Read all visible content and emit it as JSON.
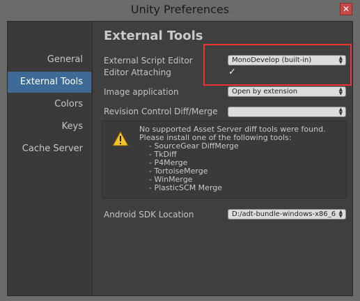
{
  "window": {
    "title": "Unity Preferences",
    "close_glyph": "✕"
  },
  "sidebar": {
    "items": [
      {
        "label": "General",
        "active": false
      },
      {
        "label": "External Tools",
        "active": true
      },
      {
        "label": "Colors",
        "active": false
      },
      {
        "label": "Keys",
        "active": false
      },
      {
        "label": "Cache Server",
        "active": false
      }
    ]
  },
  "main": {
    "title": "External Tools",
    "external_script_editor": {
      "label": "External Script Editor",
      "value": "MonoDevelop (built-in)"
    },
    "editor_attaching": {
      "label": "Editor Attaching",
      "checked": true,
      "check_glyph": "✓"
    },
    "image_application": {
      "label": "Image application",
      "value": "Open by extension"
    },
    "revision_control": {
      "label": "Revision Control Diff/Merge",
      "value": ""
    },
    "help": {
      "icon": "warning-icon",
      "lines": [
        "No supported Asset Server diff tools were found.",
        "Please install one of the following tools:",
        "    - SourceGear DiffMerge",
        "    - TkDiff",
        "    - P4Merge",
        "    - TortoiseMerge",
        "    - WinMerge",
        "    - PlasticSCM Merge"
      ]
    },
    "android_sdk": {
      "label": "Android SDK Location",
      "value": "D:/adt-bundle-windows-x86_6"
    }
  },
  "colors": {
    "selection": "#3e6b96",
    "highlight_box": "#ee3333"
  }
}
